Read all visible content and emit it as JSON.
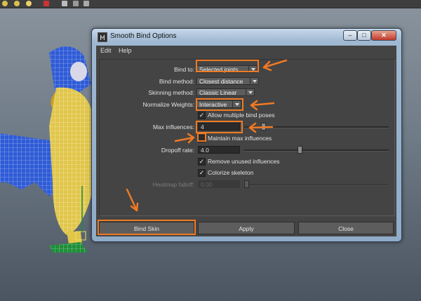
{
  "window": {
    "title": "Smooth Bind Options"
  },
  "menubar": {
    "items": [
      "Edit",
      "Help"
    ]
  },
  "form": {
    "bind_to": {
      "label": "Bind to:",
      "value": "Selected joints"
    },
    "bind_method": {
      "label": "Bind method:",
      "value": "Closest distance"
    },
    "skinning_method": {
      "label": "Skinning method:",
      "value": "Classic Linear"
    },
    "normalize_weights": {
      "label": "Normalize Weights:",
      "value": "Interactive"
    },
    "allow_multiple_bind_poses": {
      "label": "Allow multiple bind poses",
      "checked": true
    },
    "max_influences": {
      "label": "Max influences:",
      "value": "4"
    },
    "maintain_max_influences": {
      "label": "Maintain max influences",
      "checked": false
    },
    "dropoff_rate": {
      "label": "Dropoff rate:",
      "value": "4.0"
    },
    "remove_unused_influences": {
      "label": "Remove unused influences",
      "checked": true
    },
    "colorize_skeleton": {
      "label": "Colorize skeleton",
      "checked": true
    },
    "heatmap_falloff": {
      "label": "Heatmap falloff:",
      "value": "0.00",
      "disabled": true
    }
  },
  "buttons": {
    "bind_skin": "Bind Skin",
    "apply": "Apply",
    "close": "Close"
  },
  "check_glyph": "✓",
  "colors": {
    "annotation": "#f07a23",
    "panel": "#444444",
    "titlebar": "#9fb8d2"
  }
}
